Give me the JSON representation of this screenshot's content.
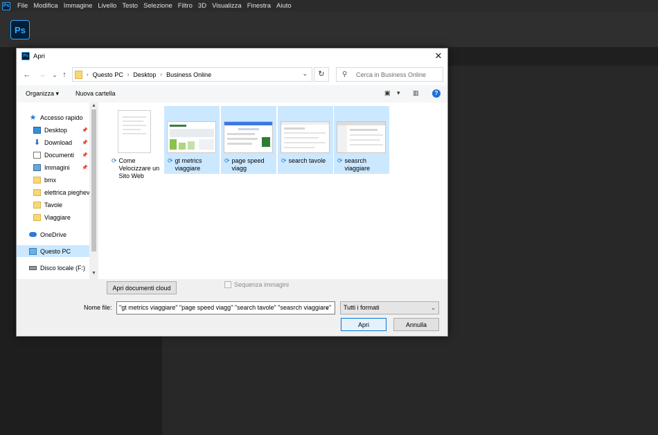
{
  "app": {
    "ps_mini_icon": "Ps",
    "logo": "Ps",
    "menu": [
      "File",
      "Modifica",
      "Immagine",
      "Livello",
      "Testo",
      "Selezione",
      "Filtro",
      "3D",
      "Visualizza",
      "Finestra",
      "Aiuto"
    ]
  },
  "dialog": {
    "icon": "Ps",
    "title": "Apri",
    "close_glyph": "✕",
    "nav": {
      "back": "←",
      "forward": "→",
      "recent": "⌄",
      "up": "↑",
      "breadcrumb": [
        "Questo PC",
        "Desktop",
        "Business Online"
      ],
      "separator": "›",
      "dropdown": "⌄",
      "refresh": "↻",
      "search_icon": "⚲",
      "search_placeholder": "Cerca in Business Online"
    },
    "commands": {
      "organize": "Organizza ▾",
      "new_folder": "Nuova cartella",
      "view_glyph": "▣",
      "view_dd": "▾",
      "pane_glyph": "▥",
      "help_glyph": "?"
    },
    "sidebar": {
      "scroll_up": "▲",
      "scroll_down": "▼",
      "pin": "📌",
      "items": [
        {
          "label": "Accesso rapido",
          "icon": "★"
        },
        {
          "label": "Desktop"
        },
        {
          "label": "Download",
          "icon": "⬇"
        },
        {
          "label": "Documenti"
        },
        {
          "label": "Immagini"
        },
        {
          "label": "bmx"
        },
        {
          "label": "elettrica pieghevole"
        },
        {
          "label": "Tavole"
        },
        {
          "label": "Viaggiare"
        },
        {
          "label": "OneDrive"
        },
        {
          "label": "Questo PC"
        },
        {
          "label": "Disco locale (F:)"
        }
      ]
    },
    "files": [
      {
        "name": "Come Velocizzare un Sito Web",
        "sync": "⟳"
      },
      {
        "name": "gt metrics viaggiare",
        "sync": "⟳"
      },
      {
        "name": "page speed viagg",
        "sync": "⟳"
      },
      {
        "name": "search tavole",
        "sync": "⟳"
      },
      {
        "name": "seasrch viaggiare",
        "sync": "⟳"
      }
    ],
    "bottom": {
      "cloud_button": "Apri documenti cloud",
      "sequence_label": "Sequenza immagini",
      "filename_label": "Nome file:",
      "filename_value": "\"gt metrics viaggiare\" \"page speed viagg\" \"search tavole\" \"seasrch viaggiare\"",
      "filename_arrow": "⌄",
      "filetype": "Tutti i formati",
      "filetype_arrow": "⌄",
      "open_button": "Apri",
      "cancel_button": "Annulla"
    }
  },
  "colors": {
    "ps_blue": "#31a8ff",
    "selection": "#cce8ff",
    "folder": "#f8d775",
    "primary_border": "#0078d7"
  }
}
